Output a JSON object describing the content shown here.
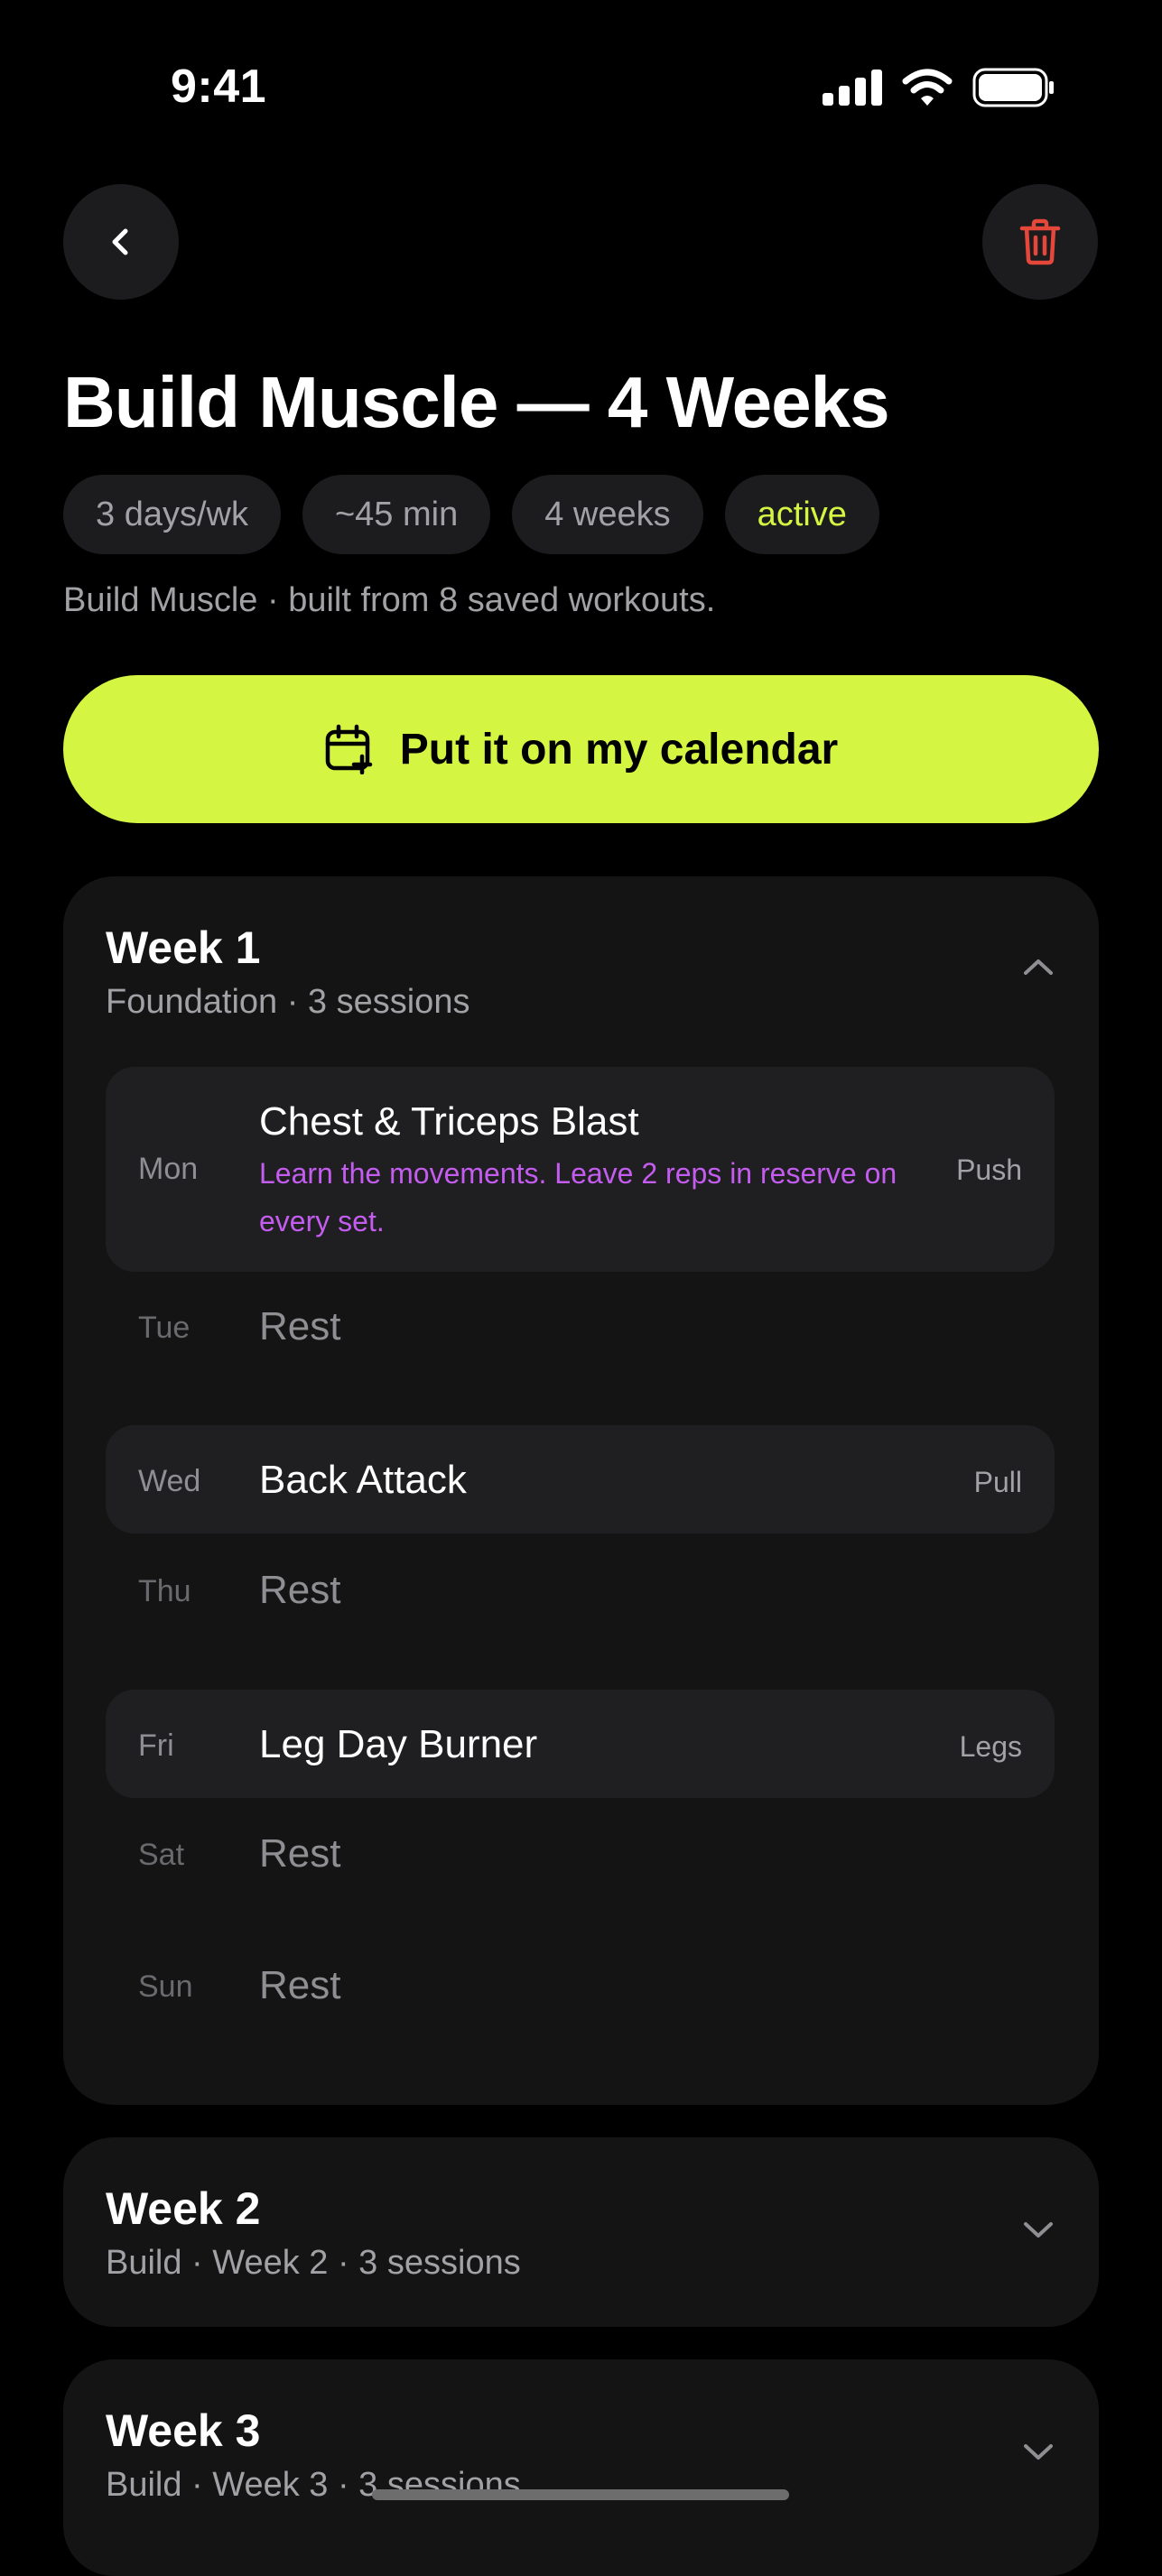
{
  "status_bar": {
    "time": "9:41"
  },
  "header": {
    "back_icon": "chevron-left-icon",
    "delete_icon": "trash-icon",
    "delete_color": "#e5483a"
  },
  "plan": {
    "title": "Build Muscle — 4 Weeks",
    "chips": [
      "3 days/wk",
      "~45 min",
      "4 weeks",
      "active"
    ],
    "subtitle": "Build Muscle · built from 8 saved workouts."
  },
  "cta": {
    "label": "Put it on my calendar",
    "icon": "calendar-plus-icon",
    "color": "#d4f542"
  },
  "weeks": [
    {
      "title": "Week 1",
      "subtitle": "Foundation · 3 sessions",
      "expanded": true,
      "days": [
        {
          "day": "Mon",
          "name": "Chest & Triceps Blast",
          "note": "Learn the movements. Leave 2 reps in reserve on every set.",
          "tag": "Push"
        },
        {
          "day": "Tue",
          "name": "Rest"
        },
        {
          "day": "Wed",
          "name": "Back Attack",
          "tag": "Pull"
        },
        {
          "day": "Thu",
          "name": "Rest"
        },
        {
          "day": "Fri",
          "name": "Leg Day Burner",
          "tag": "Legs"
        },
        {
          "day": "Sat",
          "name": "Rest"
        },
        {
          "day": "Sun",
          "name": "Rest"
        }
      ]
    },
    {
      "title": "Week 2",
      "subtitle": "Build · Week 2 · 3 sessions",
      "expanded": false
    },
    {
      "title": "Week 3",
      "subtitle": "Build · Week 3 · 3 sessions",
      "expanded": false
    }
  ],
  "colors": {
    "note": "#c45cf0",
    "card": "#141414",
    "row": "#1f1f21"
  }
}
